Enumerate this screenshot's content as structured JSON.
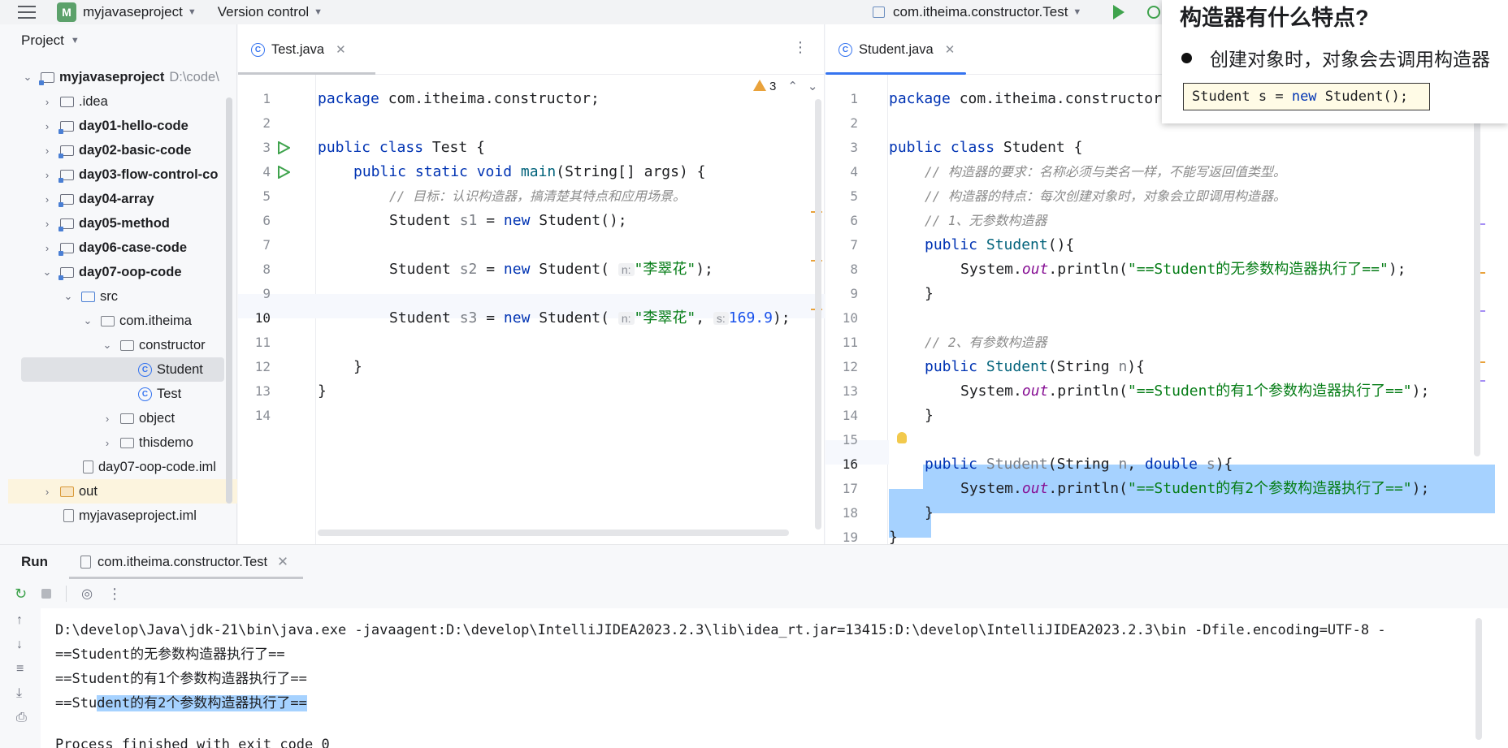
{
  "titlebar": {
    "project_badge": "M",
    "project_name": "myjavaseproject",
    "version_control": "Version control",
    "run_config": "com.itheima.constructor.Test"
  },
  "project_panel": {
    "title": "Project",
    "items": [
      {
        "label": "myjavaseproject",
        "suffix": "D:\\code\\"
      },
      {
        "label": ".idea"
      },
      {
        "label": "day01-hello-code"
      },
      {
        "label": "day02-basic-code"
      },
      {
        "label": "day03-flow-control-co"
      },
      {
        "label": "day04-array"
      },
      {
        "label": "day05-method"
      },
      {
        "label": "day06-case-code"
      },
      {
        "label": "day07-oop-code"
      },
      {
        "label": "src"
      },
      {
        "label": "com.itheima"
      },
      {
        "label": "constructor"
      },
      {
        "label": "Student"
      },
      {
        "label": "Test"
      },
      {
        "label": "object"
      },
      {
        "label": "thisdemo"
      },
      {
        "label": "day07-oop-code.iml"
      },
      {
        "label": "out"
      },
      {
        "label": "myjavaseproject.iml"
      }
    ]
  },
  "editor_left": {
    "tab": "Test.java",
    "warnings": "3",
    "line_numbers": [
      "1",
      "2",
      "3",
      "4",
      "5",
      "6",
      "7",
      "8",
      "9",
      "10",
      "11",
      "12",
      "13",
      "14"
    ],
    "l1_kw": "package",
    "l1_rest": " com.itheima.constructor;",
    "l3_kw": "public class",
    "l3_rest": " Test {",
    "l4_kw": "public static void",
    "l4_m": " main",
    "l4_rest": "(String[] args) {",
    "l5_cm": "// 目标：认识构造器，搞清楚其特点和应用场景。",
    "l6_a": "Student ",
    "l6_v": "s1",
    "l6_b": " = ",
    "l6_kw": "new",
    "l6_c": " Student();",
    "l8_a": "Student ",
    "l8_v": "s2",
    "l8_b": " = ",
    "l8_kw": "new",
    "l8_c": " Student(",
    "l8_hint": "n:",
    "l8_str": "\"李翠花\"",
    "l8_d": ");",
    "l10_a": "Student ",
    "l10_v": "s3",
    "l10_b": " = ",
    "l10_kw": "new",
    "l10_c": " Student(",
    "l10_hint1": "n:",
    "l10_str": "\"李翠花\"",
    "l10_comma": ", ",
    "l10_hint2": "s:",
    "l10_num": "169.9",
    "l10_d": ");",
    "l12": "}",
    "l13": "}"
  },
  "editor_right": {
    "tab": "Student.java",
    "line_numbers": [
      "1",
      "2",
      "3",
      "4",
      "5",
      "6",
      "7",
      "8",
      "9",
      "10",
      "11",
      "12",
      "13",
      "14",
      "15",
      "16",
      "17",
      "18",
      "19"
    ],
    "l1_kw": "package",
    "l1_rest": " com.itheima.constructor",
    "l3_kw": "public class",
    "l3_rest": " Student {",
    "l4_cm": "// 构造器的要求：名称必须与类名一样，不能写返回值类型。",
    "l5_cm": "// 构造器的特点：每次创建对象时，对象会立即调用构造器。",
    "l6_cm": "// 1、无参数构造器",
    "l7_kw": "public",
    "l7_n": " Student",
    "l7_rest": "(){",
    "l8_a": "System.",
    "l8_f": "out",
    "l8_b": ".println(",
    "l8_str": "\"==Student的无参数构造器执行了==\"",
    "l8_c": ");",
    "l9": "}",
    "l11_cm": "// 2、有参数构造器",
    "l12_kw": "public",
    "l12_n": " Student",
    "l12_a": "(String ",
    "l12_p": "n",
    "l12_b": "){",
    "l13_a": "System.",
    "l13_f": "out",
    "l13_b": ".println(",
    "l13_str": "\"==Student的有1个参数构造器执行了==\"",
    "l13_c": ");",
    "l14": "}",
    "l16_kw": "public",
    "l16_n": " Student",
    "l16_a": "(String ",
    "l16_p1": "n",
    "l16_b": ", ",
    "l16_kw2": "double",
    "l16_p2": " s",
    "l16_c": "){",
    "l17_a": "System.",
    "l17_f": "out",
    "l17_b": ".println(",
    "l17_str": "\"==Student的有2个参数构造器执行了==\"",
    "l17_c": ");",
    "l18": "}",
    "l19": "}"
  },
  "slide": {
    "title": "构造器有什么特点?",
    "bullet": "创建对象时，对象会去调用构造器",
    "code_a": "Student s = ",
    "code_kw": "new",
    "code_b": " Student();"
  },
  "run_panel": {
    "title": "Run",
    "tab": "com.itheima.constructor.Test",
    "lines": [
      "D:\\develop\\Java\\jdk-21\\bin\\java.exe -javaagent:D:\\develop\\IntelliJIDEA2023.2.3\\lib\\idea_rt.jar=13415:D:\\develop\\IntelliJIDEA2023.2.3\\bin -Dfile.encoding=UTF-8 -",
      "==Student的无参数构造器执行了==",
      "==Student的有1个参数构造器执行了=="
    ],
    "line4_a": "==Stu",
    "line4_sel": "dent的有2个参数构造器执行了==",
    "line5": "Process finished with exit code 0"
  },
  "colors": {
    "accent": "#3574f0",
    "selection": "#a6d2ff",
    "run_green": "#3fa34d"
  }
}
